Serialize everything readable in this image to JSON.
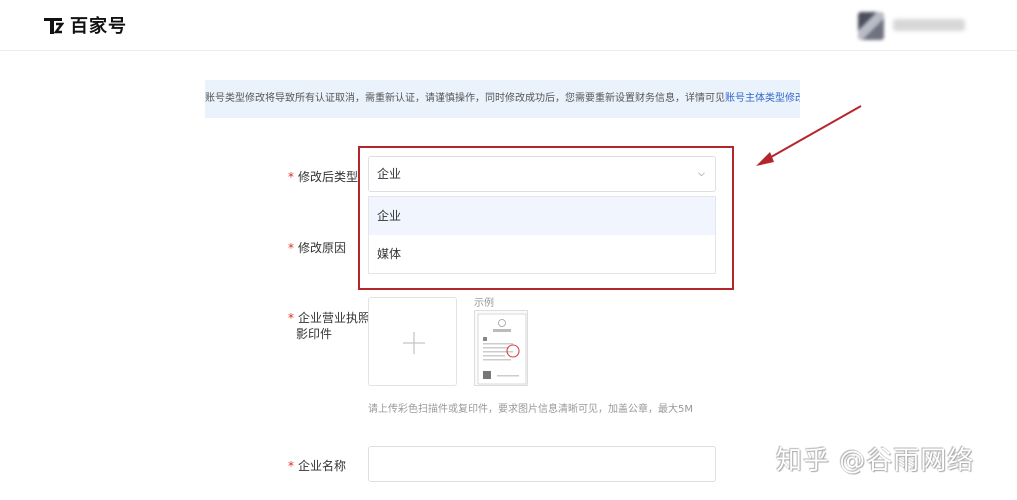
{
  "header": {
    "logo_text": "百家号",
    "username": ""
  },
  "notice": {
    "text": "账号类型修改将导致所有认证取消，需重新认证，请谨慎操作，同时修改成功后，您需要重新设置财务信息，详情可见",
    "link": "账号主体类型修改说明"
  },
  "form": {
    "type_label": "修改后类型",
    "type_value": "企业",
    "type_options": [
      "企业",
      "媒体"
    ],
    "reason_label": "修改原因",
    "license_label_line1": "企业营业执照",
    "license_label_line2": "影印件",
    "sample_label": "示例",
    "upload_hint": "请上传彩色扫描件或复印件，要求图片信息清晰可见，加盖公章，最大5M",
    "company_name_label": "企业名称",
    "company_name_value": "",
    "required_mark": "*"
  },
  "watermark": "知乎 @谷雨网络",
  "colors": {
    "accent_red": "#b5262c",
    "required": "#e02e24",
    "link": "#3466c9",
    "notice_bg": "#eaf3fc",
    "option_active_bg": "#f0f5fe"
  }
}
